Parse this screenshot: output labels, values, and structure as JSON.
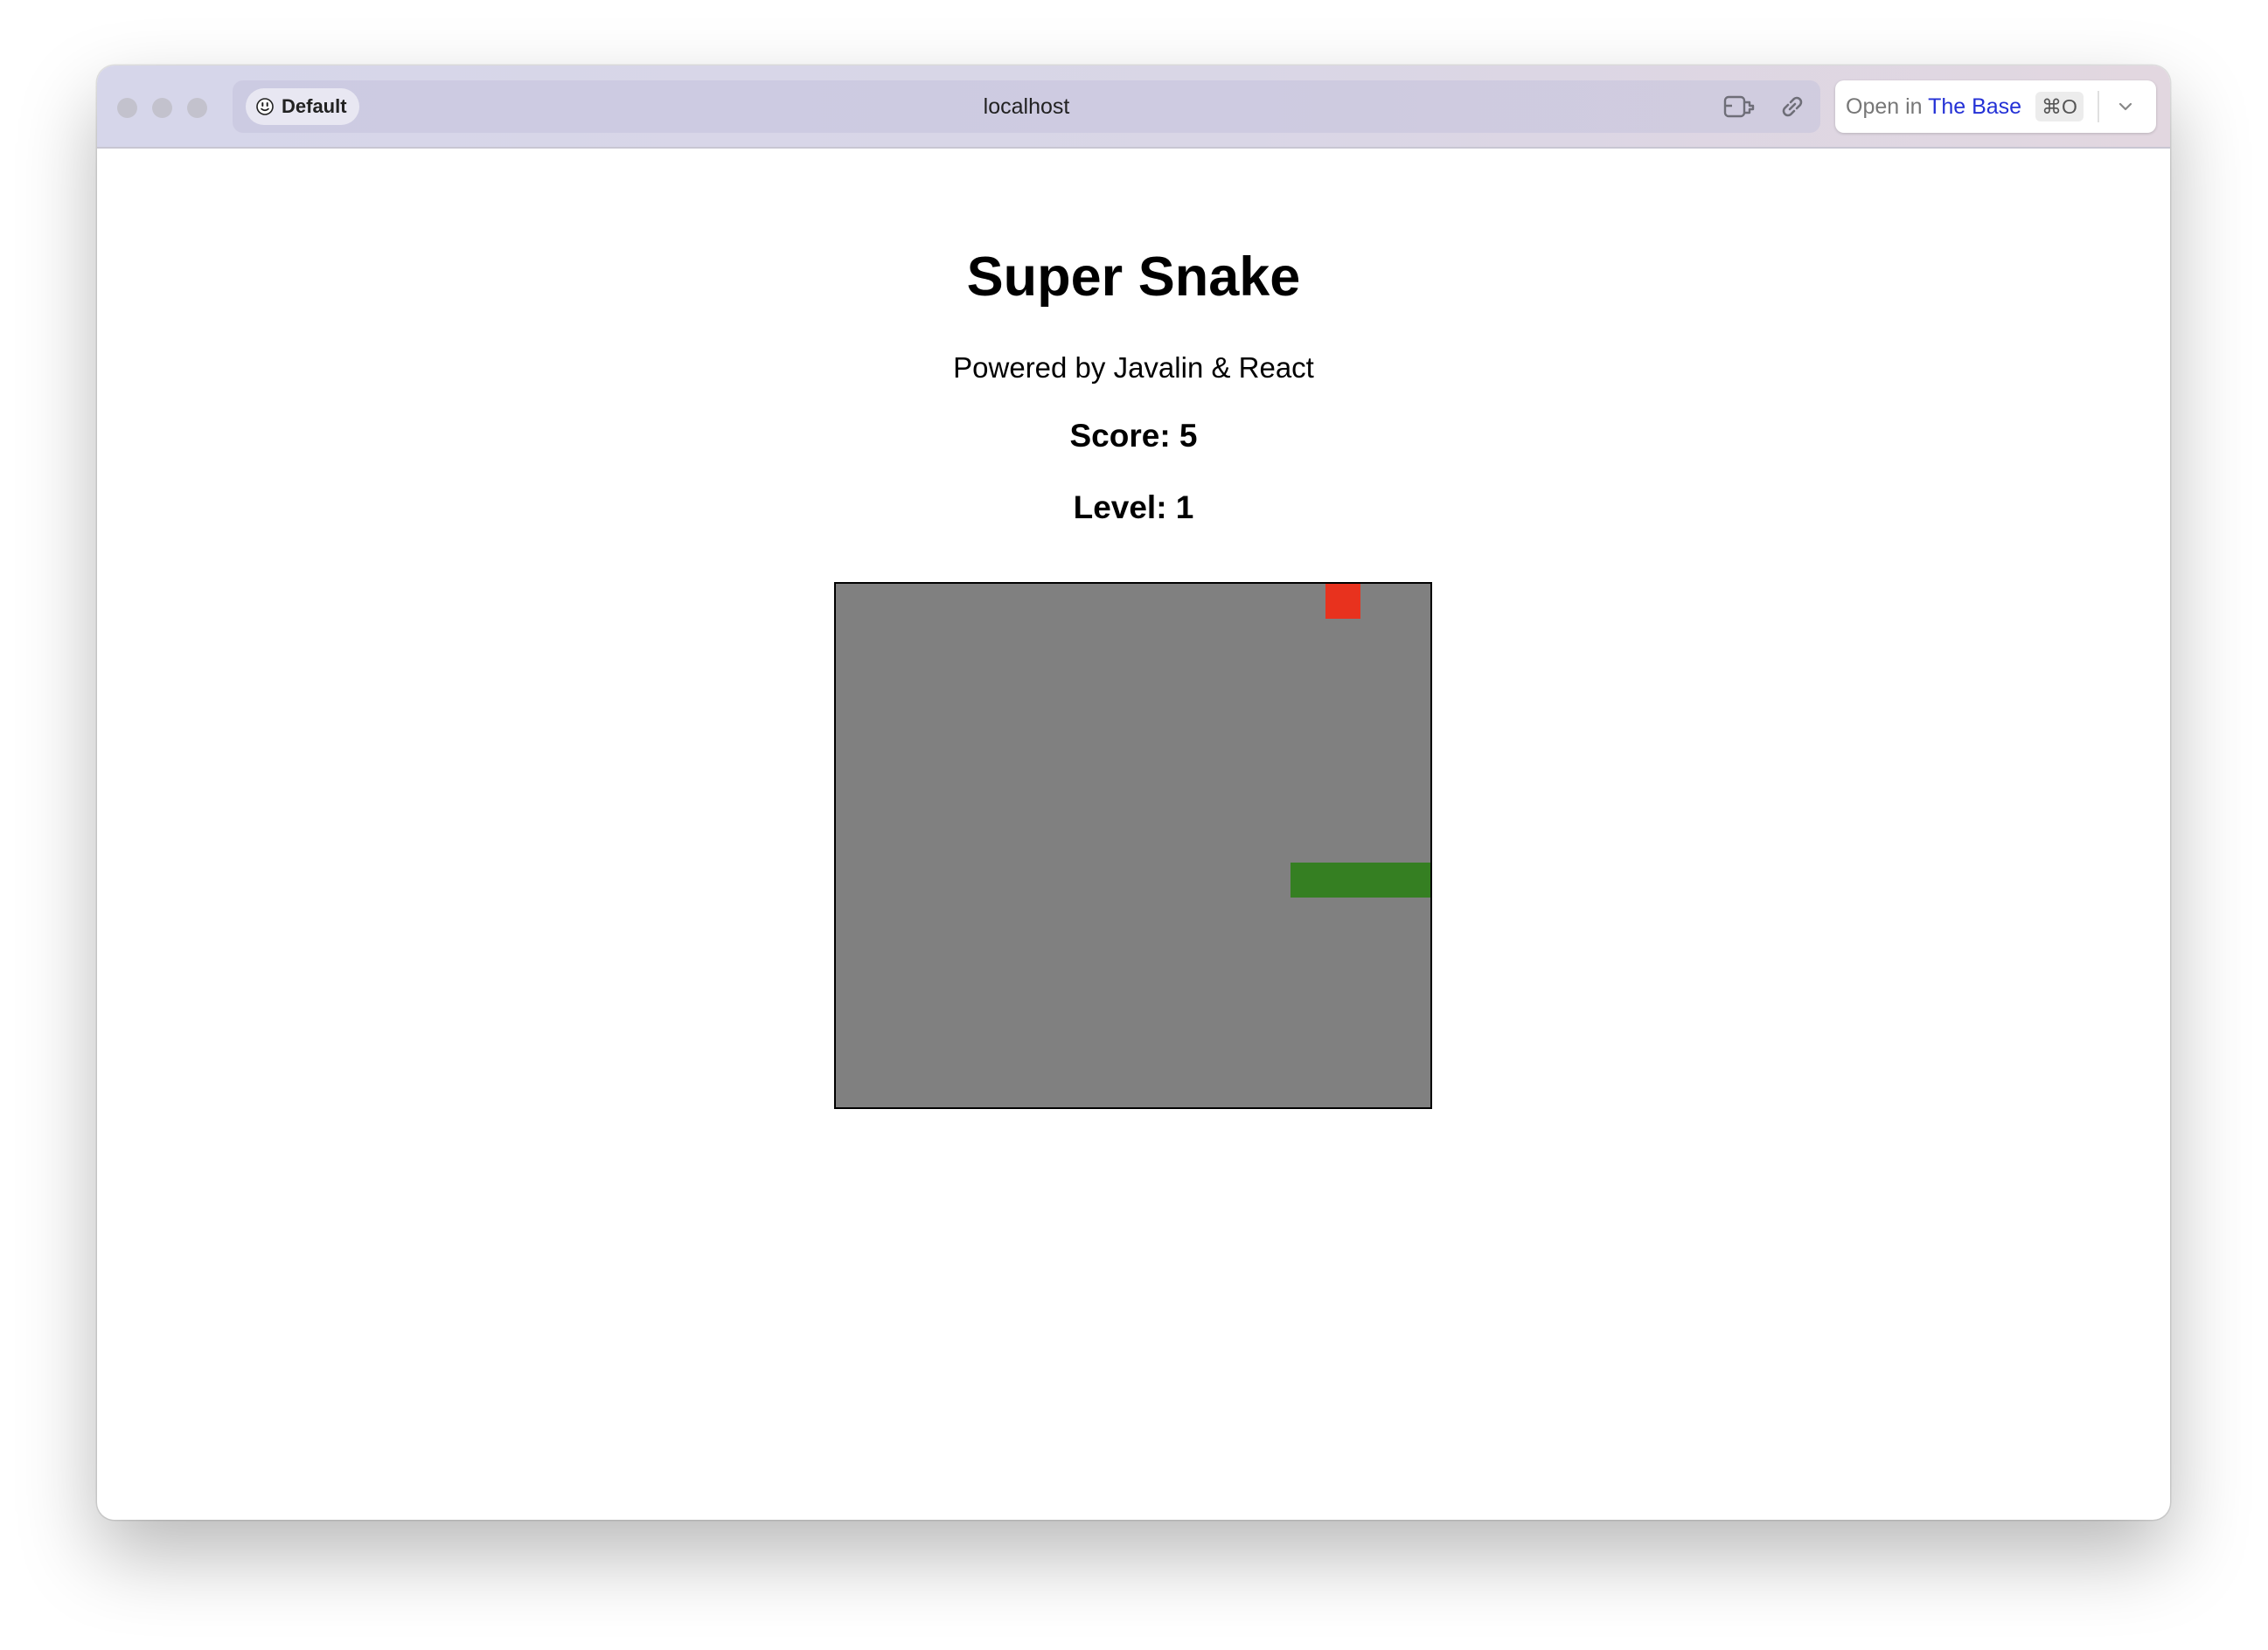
{
  "browser": {
    "profile_label": "Default",
    "url": "localhost",
    "open_in_prefix": "Open in",
    "open_in_app": "The Base",
    "shortcut": "⌘O"
  },
  "page": {
    "title": "Super Snake",
    "subtitle": "Powered by Javalin & React",
    "score_text": "Score: 5",
    "level_text": "Level: 1"
  },
  "game": {
    "grid_cols": 17,
    "grid_rows": 15,
    "board_color": "#808080",
    "food_color": "#e8321e",
    "snake_color": "#357f22",
    "food": {
      "col": 14,
      "row": 0
    },
    "snake": [
      {
        "col": 16,
        "row": 8
      },
      {
        "col": 15,
        "row": 8
      },
      {
        "col": 14,
        "row": 8
      },
      {
        "col": 13,
        "row": 8
      }
    ]
  },
  "icons": [
    "smiley-icon",
    "reader-icon",
    "link-icon",
    "chevron-down-icon"
  ]
}
